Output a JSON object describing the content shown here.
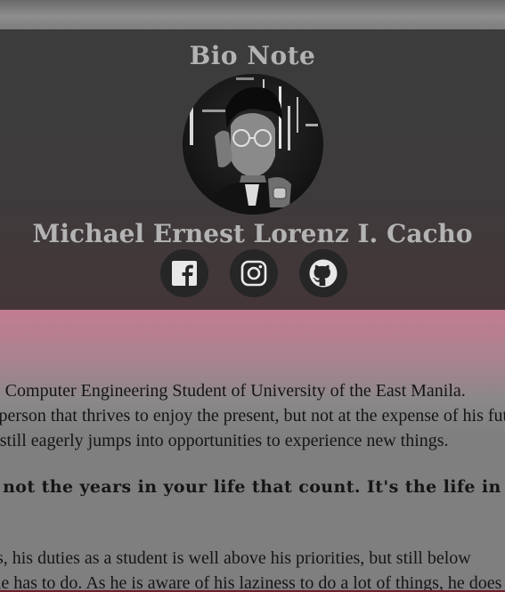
{
  "header": {
    "title": "Bio Note",
    "name": "Michael Ernest Lorenz I. Cacho"
  },
  "social": [
    {
      "name": "facebook-icon"
    },
    {
      "name": "instagram-icon"
    },
    {
      "name": "github-icon"
    }
  ],
  "content": {
    "paragraph1": [
      "is a BS Computer Engineering Student of University of the East Manila.",
      "He is a person that thrives to enjoy the present, but not at the expense of his future.",
      "As such, he still eagerly jumps into opportunities to experience new things."
    ],
    "quote": "\"It's not the years in your life that count. It's the life in your years.\"",
    "paragraph2": [
      "Nonetheless, his duties as a student is well above his priorities, but still below",
      "the things he has to do. As he is aware of his laziness to do a lot of things, he does"
    ]
  },
  "colors": {
    "header_bg": "#3c3c3c",
    "header_text": "#b3b3b3",
    "accent_pink": "#c37c92",
    "content_bg": "#7f7f7f"
  }
}
